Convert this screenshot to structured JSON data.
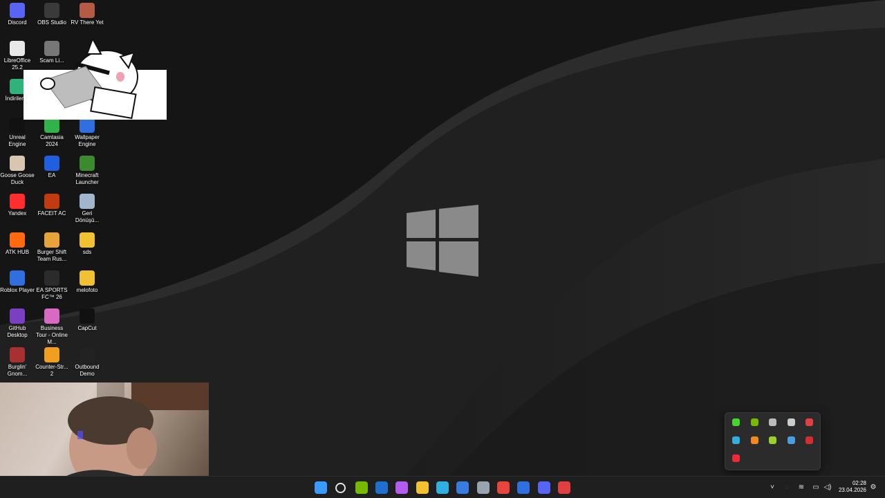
{
  "desktop": {
    "icons": [
      {
        "label": "Discord",
        "icon": "discord-icon",
        "color": "#5865F2"
      },
      {
        "label": "OBS Studio",
        "icon": "obs-icon",
        "color": "#3a3a3a"
      },
      {
        "label": "RV There Yet",
        "icon": "rv-there-yet-icon",
        "color": "#b55a45"
      },
      {
        "label": "LibreOffice 25.2",
        "icon": "libreoffice-icon",
        "color": "#e8e8e8"
      },
      {
        "label": "Scam Li...",
        "icon": "scam-icon",
        "color": "#777777"
      },
      {
        "label": "İndirilen...",
        "icon": "downloads-icon",
        "color": "#2fb37a"
      },
      {
        "label": "Unreal Engine",
        "icon": "unreal-engine-icon",
        "color": "#111111"
      },
      {
        "label": "Camtasia 2024",
        "icon": "camtasia-icon",
        "color": "#2fb34a"
      },
      {
        "label": "Wallpaper Engine",
        "icon": "wallpaper-engine-icon",
        "color": "#2f6fe0"
      },
      {
        "label": "Goose Goose Duck",
        "icon": "goose-goose-duck-icon",
        "color": "#d9c6b0"
      },
      {
        "label": "EA",
        "icon": "ea-icon",
        "color": "#1f5fe0"
      },
      {
        "label": "Minecraft Launcher",
        "icon": "minecraft-icon",
        "color": "#3c8a2e"
      },
      {
        "label": "Yandex",
        "icon": "yandex-icon",
        "color": "#ff2d2d"
      },
      {
        "label": "FACEIT AC",
        "icon": "faceit-icon",
        "color": "#c23a10"
      },
      {
        "label": "Geri Dönüşü...",
        "icon": "recycle-bin-icon",
        "color": "#9fb6cc"
      },
      {
        "label": "ATK HUB",
        "icon": "atk-hub-icon",
        "color": "#ff6a10"
      },
      {
        "label": "Burger Shift Team Rus...",
        "icon": "burger-shift-icon",
        "color": "#e8a23a"
      },
      {
        "label": "sds",
        "icon": "folder-icon",
        "color": "#f2c132"
      },
      {
        "label": "Roblox Player",
        "icon": "roblox-icon",
        "color": "#2f6fe0"
      },
      {
        "label": "EA SPORTS FC™ 26",
        "icon": "ea-sports-fc-icon",
        "color": "#2b2b2b"
      },
      {
        "label": "melofoto",
        "icon": "folder-icon",
        "color": "#f2c132"
      },
      {
        "label": "GitHub Desktop",
        "icon": "github-desktop-icon",
        "color": "#7a3fc2"
      },
      {
        "label": "Business Tour - Online M...",
        "icon": "business-tour-icon",
        "color": "#d86ac4"
      },
      {
        "label": "CapCut",
        "icon": "capcut-icon",
        "color": "#111111"
      },
      {
        "label": "Burglin' Gnom...",
        "icon": "burglin-gnomes-icon",
        "color": "#a83030"
      },
      {
        "label": "Counter-Str... 2",
        "icon": "counter-strike-icon",
        "color": "#f0a020"
      },
      {
        "label": "Outbound Demo",
        "icon": "outbound-icon",
        "color": "#222222"
      }
    ]
  },
  "tray_popup": {
    "icons": [
      {
        "icon": "razer-icon",
        "color": "#44d62c"
      },
      {
        "icon": "nvidia-icon",
        "color": "#76b900"
      },
      {
        "icon": "vpn-icon",
        "color": "#bbbbbb"
      },
      {
        "icon": "steam-icon",
        "color": "#cccccc"
      },
      {
        "icon": "shield-icon",
        "color": "#e04040"
      },
      {
        "icon": "edge-icon",
        "color": "#2fb0e0"
      },
      {
        "icon": "winrar-icon",
        "color": "#f08a20"
      },
      {
        "icon": "nvidia-app-icon",
        "color": "#9ad02a"
      },
      {
        "icon": "onedrive-icon",
        "color": "#4a9fe0"
      },
      {
        "icon": "microphone-icon",
        "color": "#d03030"
      },
      {
        "icon": "record-icon",
        "color": "#ee2a3a"
      }
    ]
  },
  "taskbar": {
    "apps": [
      {
        "icon": "start-icon",
        "color": "#3a9bff"
      },
      {
        "icon": "search-icon",
        "color": "#e6e6e6"
      },
      {
        "icon": "nvidia-app-icon",
        "color": "#76b900"
      },
      {
        "icon": "outlook-icon",
        "color": "#1f6fd0"
      },
      {
        "icon": "copilot-icon",
        "color": "#b35cf0"
      },
      {
        "icon": "file-explorer-icon",
        "color": "#f2c132"
      },
      {
        "icon": "edge-icon",
        "color": "#2fb0e0"
      },
      {
        "icon": "microsoft-store-icon",
        "color": "#3a7be0"
      },
      {
        "icon": "settings-icon",
        "color": "#9aa4b0"
      },
      {
        "icon": "chrome-icon",
        "color": "#e8453c"
      },
      {
        "icon": "wallpaper-engine-icon",
        "color": "#2f6fe0"
      },
      {
        "icon": "discord-icon",
        "color": "#5865F2"
      },
      {
        "icon": "steelseries-icon",
        "color": "#e04040"
      }
    ],
    "tray": {
      "chevron": "chevron-up-icon",
      "network": "network-icon",
      "wifi": "wifi-icon",
      "volume": "volume-icon",
      "time": "02:28",
      "date": "23.04.2026",
      "notification": "notification-icon"
    }
  }
}
